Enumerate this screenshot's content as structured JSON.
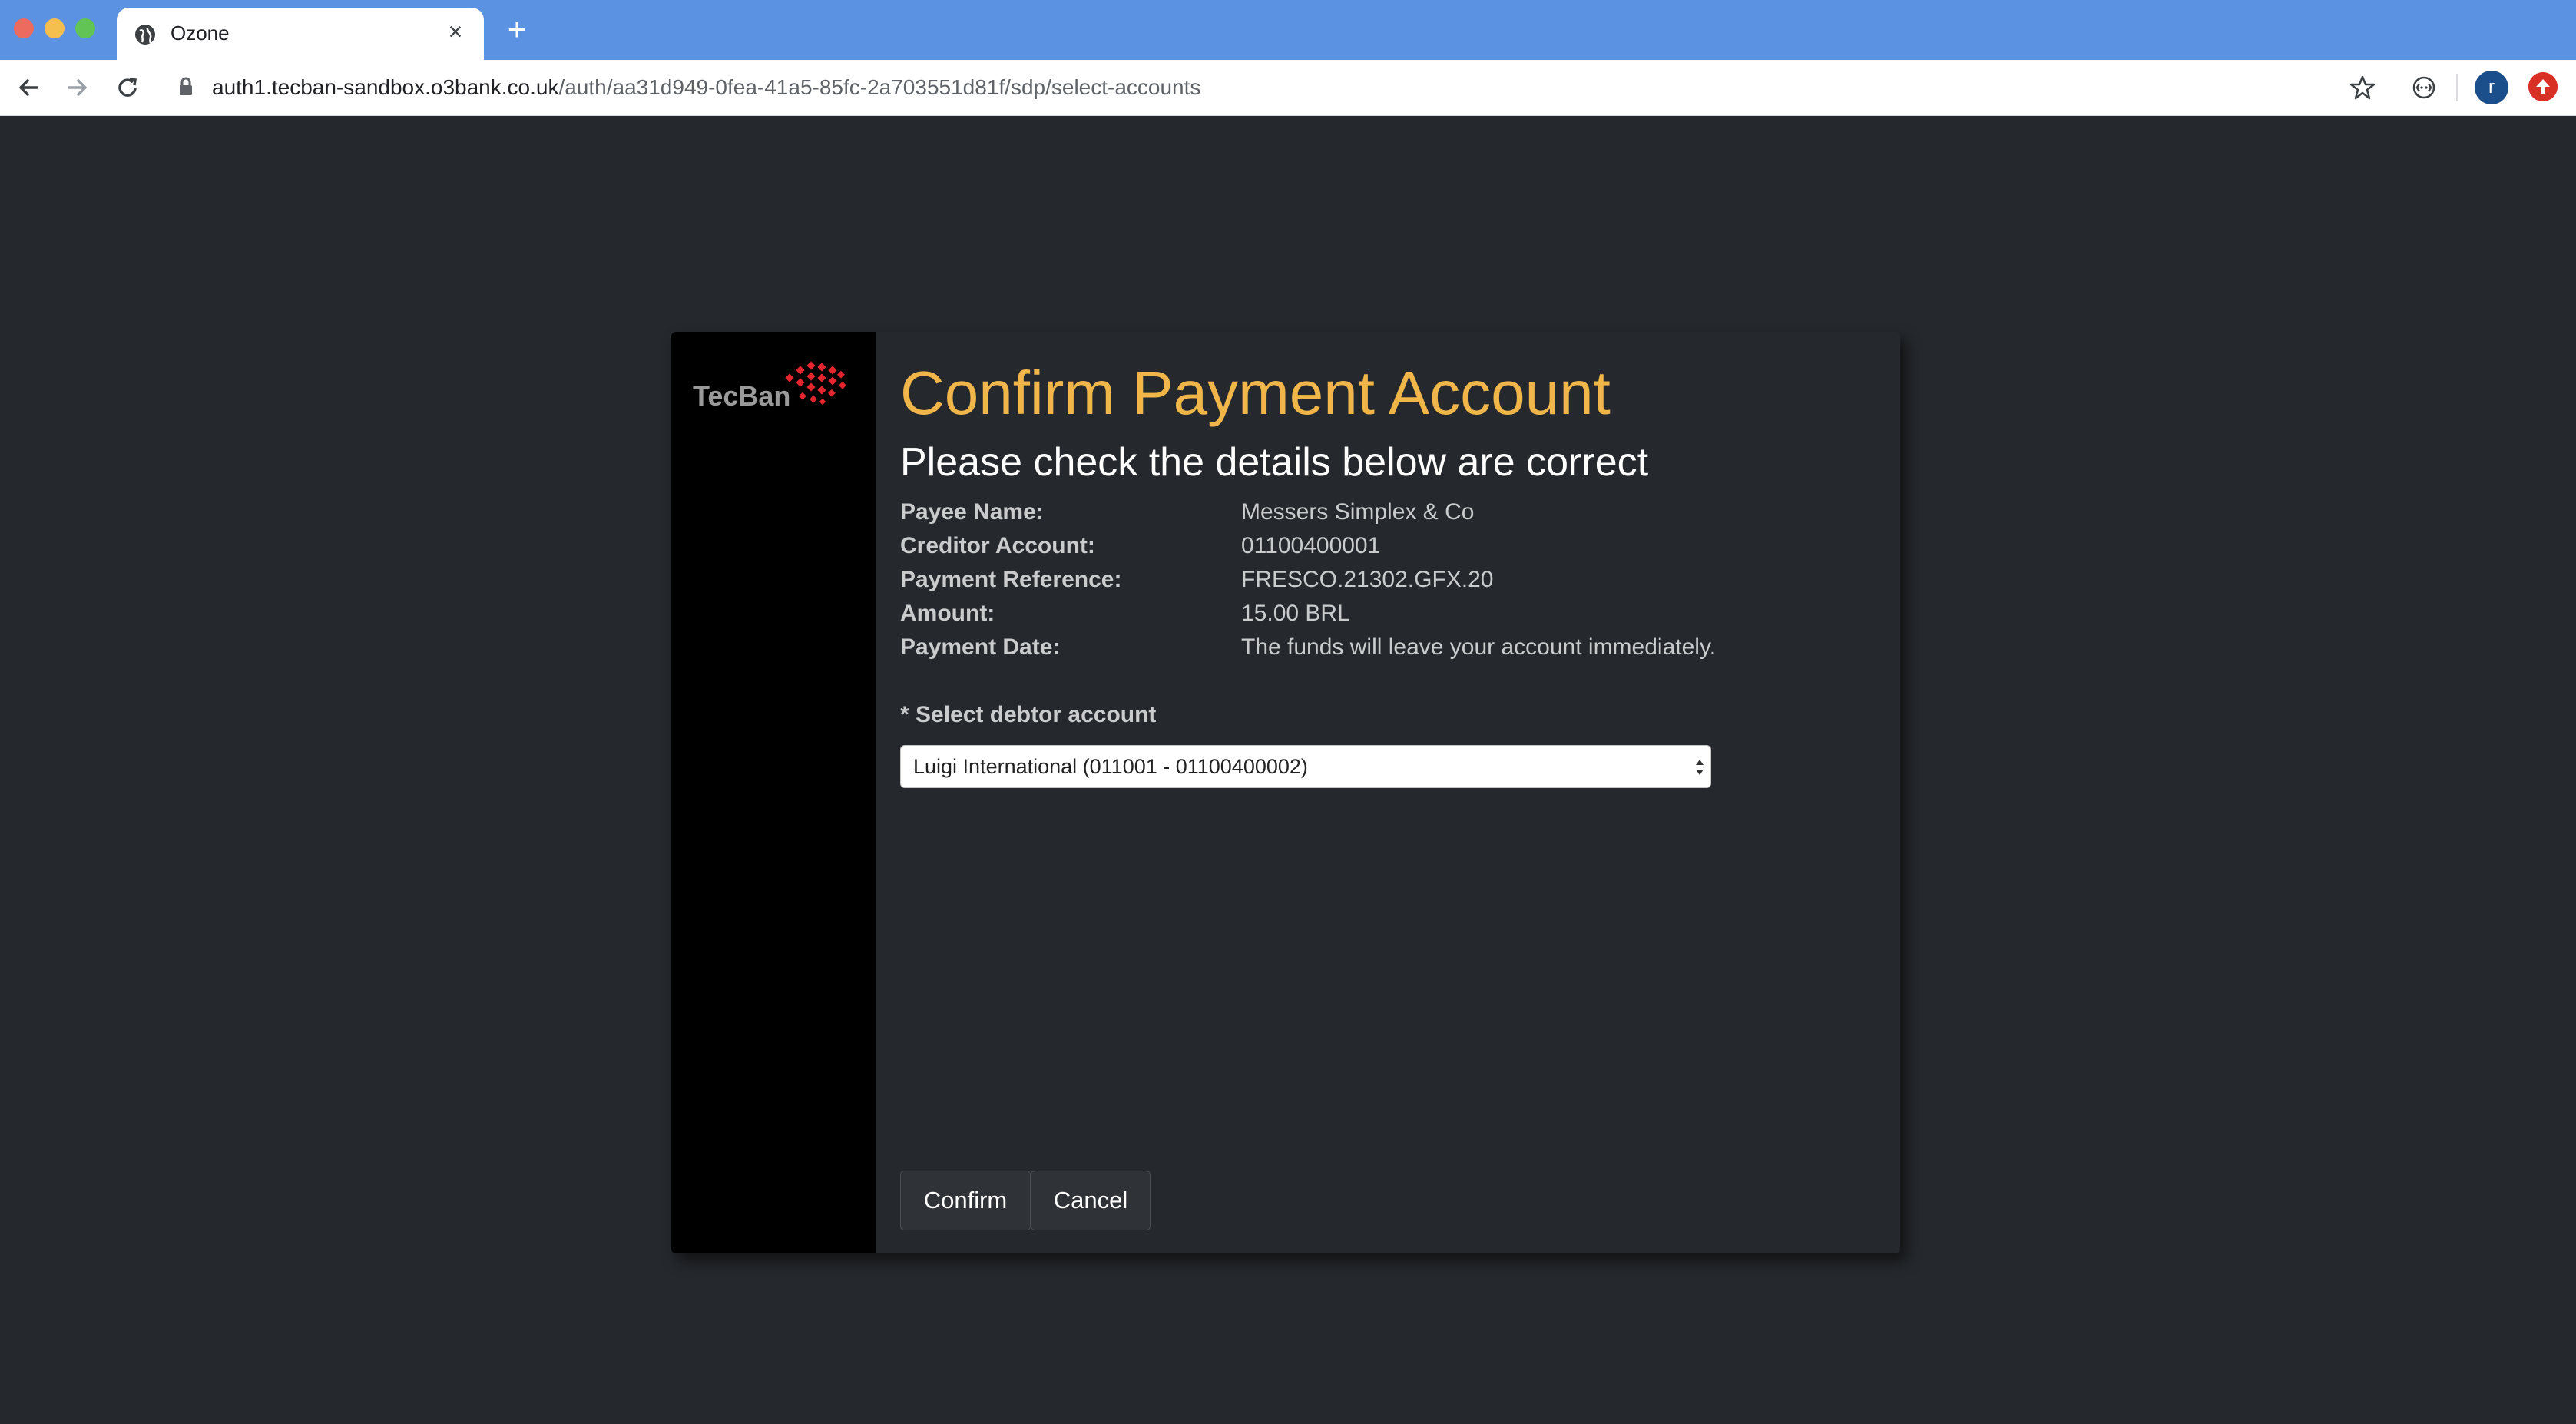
{
  "browser": {
    "tab_title": "Ozone",
    "url_host": "auth1.tecban-sandbox.o3bank.co.uk",
    "url_path": "/auth/aa31d949-0fea-41a5-85fc-2a703551d81f/sdp/select-accounts",
    "profile_initial": "r",
    "icons": [
      "globe-icon",
      "close-icon",
      "plus-icon",
      "back-arrow-icon",
      "forward-arrow-icon",
      "reload-icon",
      "lock-icon",
      "star-icon",
      "extension-icon",
      "avatar",
      "update-icon"
    ]
  },
  "dialog": {
    "logo_text": "TecBan",
    "title": "Confirm Payment Account",
    "subtitle": "Please check the details below are correct",
    "details": [
      {
        "label": "Payee Name:",
        "value": "Messers Simplex & Co"
      },
      {
        "label": "Creditor Account:",
        "value": "01100400001"
      },
      {
        "label": "Payment Reference:",
        "value": "FRESCO.21302.GFX.20"
      },
      {
        "label": "Amount:",
        "value": "15.00 BRL"
      },
      {
        "label": "Payment Date:",
        "value": "The funds will leave your account immediately."
      }
    ],
    "select_label": "* Select debtor account",
    "selected_account": "Luigi International (011001 - 01100400002)",
    "confirm_label": "Confirm",
    "cancel_label": "Cancel"
  },
  "colors": {
    "page_background": "#25282c",
    "title_accent": "#f0b64a",
    "tab_strip": "#5b92e2",
    "logo_red": "#e3262e"
  }
}
